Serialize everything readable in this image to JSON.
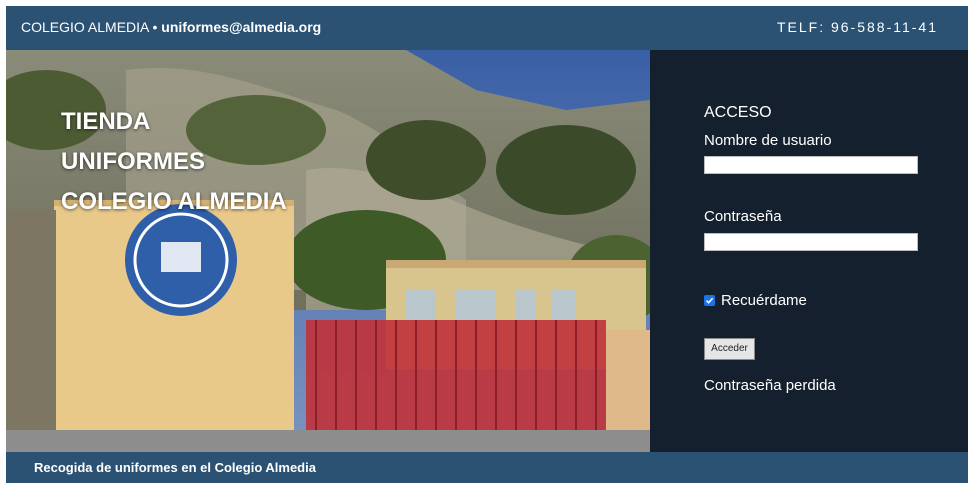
{
  "topbar": {
    "school": "COLEGIO ALMEDIA • ",
    "email": "uniformes@almedia.org",
    "phone": "TELF: 96-588-11-41"
  },
  "hero": {
    "title_lines": [
      "TIENDA",
      "UNIFORMES",
      "COLEGIO ALMEDIA"
    ]
  },
  "login": {
    "heading": "ACCESO",
    "username_label": "Nombre de usuario",
    "username_value": "",
    "password_label": "Contraseña",
    "password_value": "",
    "remember_label": "Recuérdame",
    "remember_checked": true,
    "submit_label": "Acceder",
    "lost_password": "Contraseña perdida"
  },
  "footer": {
    "text": "Recogida de uniformes en el Colegio Almedia"
  },
  "colors": {
    "bar_blue": "#2b5273",
    "panel_dark": "#14202e",
    "checkbox_blue": "#1a73e8"
  }
}
